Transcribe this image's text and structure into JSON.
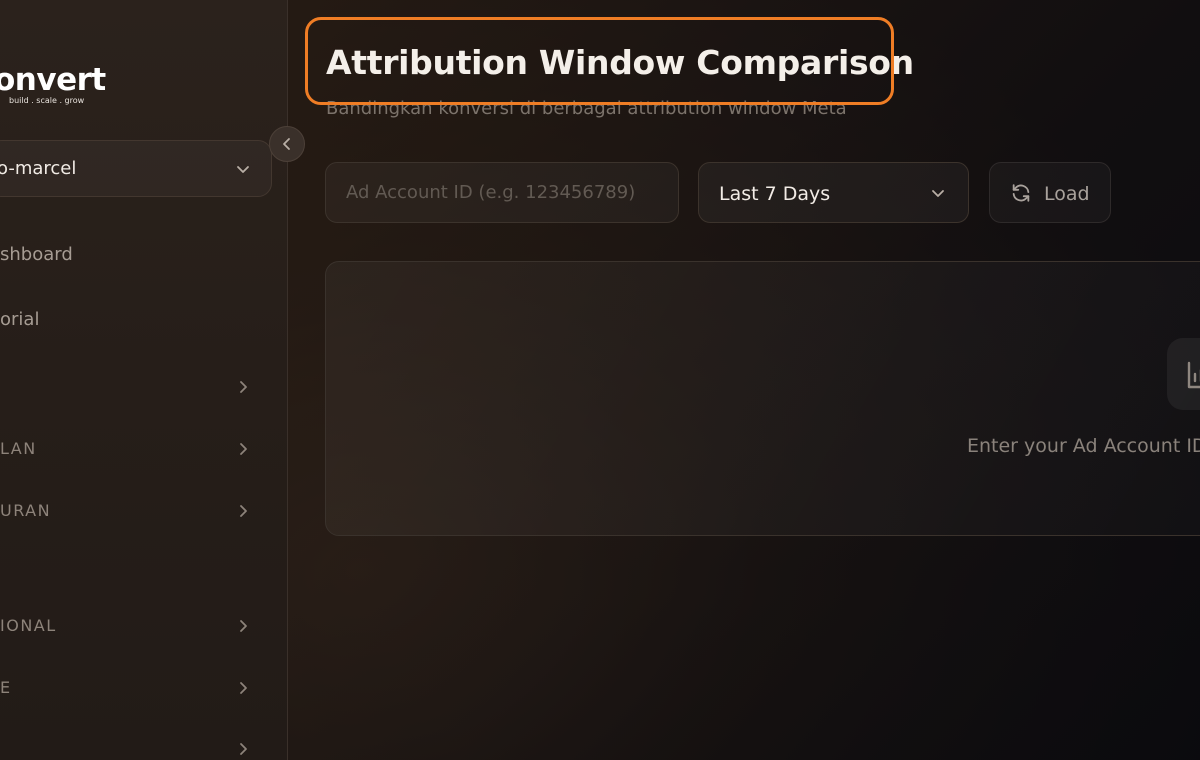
{
  "brand": {
    "logo_text": "onvert",
    "tagline": "build . scale . grow"
  },
  "workspace": {
    "name": "o-marcel"
  },
  "sidebar": {
    "items": [
      {
        "label": "shboard",
        "has_chevron": false,
        "section": false
      },
      {
        "label": "orial",
        "has_chevron": false,
        "section": false
      },
      {
        "label": "",
        "has_chevron": true,
        "section": true
      },
      {
        "label": "LAN",
        "has_chevron": true,
        "section": true
      },
      {
        "label": "URAN",
        "has_chevron": true,
        "section": true
      },
      {
        "label": "IONAL",
        "has_chevron": true,
        "section": true
      },
      {
        "label": "E",
        "has_chevron": true,
        "section": true
      },
      {
        "label": "",
        "has_chevron": true,
        "section": true
      }
    ]
  },
  "page": {
    "title": "Attribution Window Comparison",
    "subtitle": "Bandingkan konversi di berbagai attribution window Meta"
  },
  "controls": {
    "ad_account_placeholder": "Ad Account ID (e.g. 123456789)",
    "ad_account_value": "",
    "date_range_selected": "Last 7 Days",
    "load_label": "Load"
  },
  "empty_state": {
    "message": "Enter your Ad Account ID"
  },
  "colors": {
    "highlight": "#ef7d25",
    "background": "#1d1611"
  }
}
